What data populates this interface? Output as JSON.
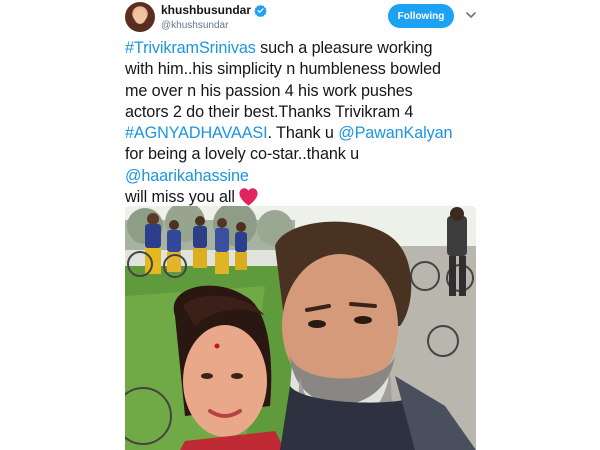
{
  "user": {
    "display_name": "khushbusundar",
    "handle": "@khushsundar",
    "verified": true
  },
  "follow_button": {
    "label": "Following"
  },
  "icons": {
    "verified": "verified-badge-icon",
    "more": "chevron-down-icon",
    "heart": "heart-icon"
  },
  "tweet": {
    "line1": {
      "hashtag": "#TrivikramSrinivas",
      "text": " such a pleasure working"
    },
    "line2": "with him..his simplicity n humbleness bowled",
    "line3": "me over n his passion 4 his work pushes",
    "line4": "actors 2 do their best.Thanks Trivikram 4",
    "line5": {
      "hashtag": "#AGNYADHAVAASI",
      "text": ". Thank u ",
      "mention": "@PawanKalyan"
    },
    "line6": "for being a lovely co-star..thank u",
    "line7": {
      "mention": "@haarikahassine"
    },
    "line8": "will miss you all"
  },
  "colors": {
    "accent": "#1da1f2",
    "link": "#1b95e0",
    "text": "#14171a",
    "secondary_text": "#657786",
    "heart": "#e0245e"
  }
}
